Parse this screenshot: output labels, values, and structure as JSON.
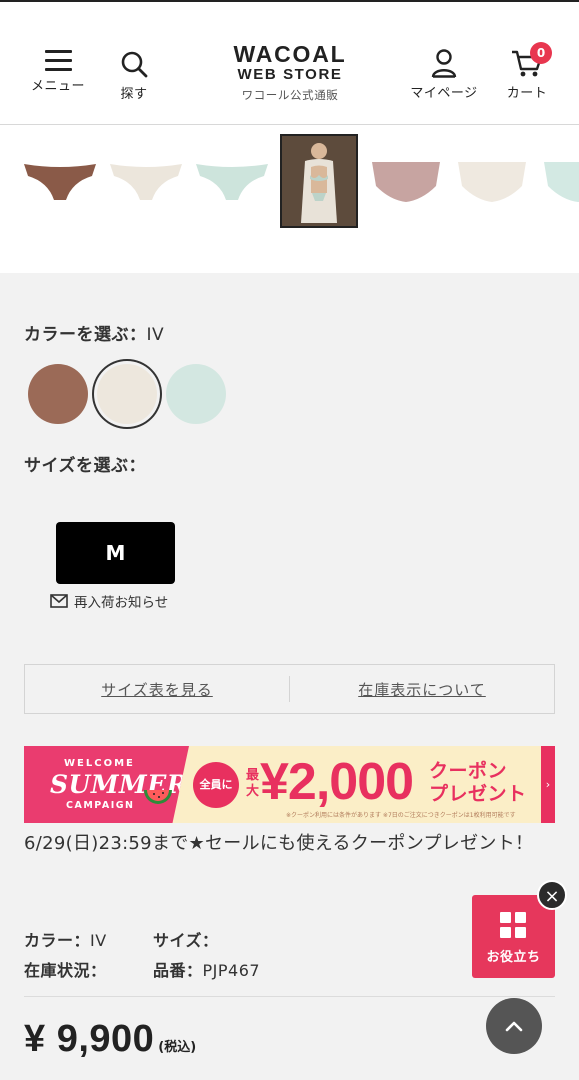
{
  "header": {
    "menu_label": "メニュー",
    "search_label": "探す",
    "logo_line1": "WACOAL",
    "logo_line2": "WEB STORE",
    "logo_line3": "ワコール公式通販",
    "mypage_label": "マイページ",
    "cart_label": "カート",
    "cart_count": "0"
  },
  "thumbnails": [
    {
      "name": "thumb-brown",
      "color": "#8a5a48"
    },
    {
      "name": "thumb-ivory",
      "color": "#efe9df"
    },
    {
      "name": "thumb-mint",
      "color": "#cfe6df"
    },
    {
      "name": "thumb-model",
      "color": "#6b5a4a",
      "selected": true
    },
    {
      "name": "thumb-pink",
      "color": "#c9a7a4"
    },
    {
      "name": "thumb-cream",
      "color": "#f1ece4"
    },
    {
      "name": "thumb-aqua",
      "color": "#d6ebe6"
    }
  ],
  "color": {
    "label": "カラーを選ぶ：",
    "selected": "IV",
    "swatches": [
      {
        "name": "brown",
        "color": "#9b6a57"
      },
      {
        "name": "ivory",
        "color": "#ede7dd",
        "selected": true
      },
      {
        "name": "mint",
        "color": "#d3e7e1"
      }
    ]
  },
  "size": {
    "label": "サイズを選ぶ：",
    "option": "M",
    "restock_label": "再入荷お知らせ"
  },
  "links": {
    "size_chart": "サイズ表を見る",
    "stock_info": "在庫表示について"
  },
  "banner": {
    "welcome": "WELCOME",
    "summer": "SUMMER",
    "campaign": "CAMPAIGN",
    "all_members": "全員に",
    "max": "最大",
    "amount": "¥2,000",
    "coupon_line1": "クーポン",
    "coupon_line2": "プレゼント",
    "note": "※クーポン利用には条件があります ※7日のご注文につきクーポンは1枚利用可能です"
  },
  "promo_text": "6/29(日)23:59まで★セールにも使えるクーポンプレゼント！",
  "meta": {
    "color_label": "カラー：",
    "color_value": "IV",
    "size_label": "サイズ：",
    "size_value": "",
    "stock_label": "在庫状況：",
    "stock_value": "",
    "sku_label": "品番：",
    "sku_value": "PJP467"
  },
  "price": {
    "amount": "¥ 9,900",
    "tax": "(税込)"
  },
  "floating": {
    "helpful_label": "お役立ち",
    "close": "×"
  },
  "colors": {
    "accent": "#e6375c",
    "badge": "#e8364f"
  }
}
